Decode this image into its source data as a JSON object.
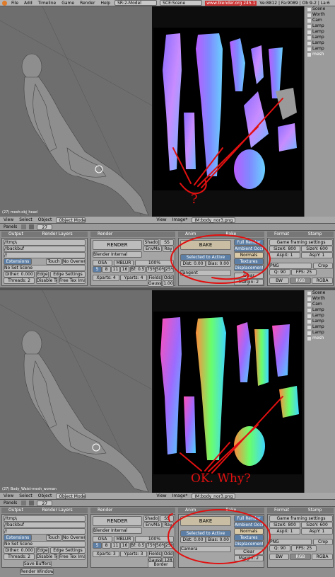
{
  "topbar": {
    "menus": [
      "File",
      "Add",
      "Timeline",
      "Game",
      "Render",
      "Help"
    ],
    "screen": "SR:2-Model",
    "scene": "SCE:Scene",
    "site": "www.blender.org 245.1",
    "stats": "Ve:8812 | Fa:9089 | Ob:9-2 | La:6"
  },
  "outliner": {
    "items": [
      "Scene",
      "Worth",
      "Cam",
      "Lamp",
      "Lamp",
      "Lamp",
      "Lamp",
      "Lamp",
      "mesh"
    ]
  },
  "top": {
    "status_label": "(27) mesh:obj_head",
    "annotation": "?"
  },
  "bottom": {
    "status_label": "(27) Body_Waist-mesh_woman",
    "annotation": "OK. Why?"
  },
  "view_header": {
    "view": "View",
    "select": "Select",
    "object": "Object",
    "mode": "Object Mode",
    "uv_view": "View",
    "image": "Image*",
    "image_name_top": "IM:body_nor3.png",
    "image_name_bottom": "IM:body_nor3.png"
  },
  "buttons_header": {
    "panels": "Panels",
    "frame": "27"
  },
  "panels": {
    "output": {
      "tab": "Output",
      "tab2": "Render Layers",
      "path1": "//tmp\\",
      "path2": "//backbuf",
      "path3": "//",
      "extensions": "Extensions",
      "touch": "Touch",
      "no_overwrite": "No Overwrite",
      "no_set_scene": "No Set Scene",
      "dither": "Dither: 0.000",
      "edge": "Edge",
      "edge_settings": "Edge Settings",
      "threads": "Threads: 2",
      "disable_tex": "Disable Tex",
      "free_tex": "Free Tex Imag",
      "save_buffers": "Save Buffers",
      "render_window": "Render Window"
    },
    "render": {
      "tab": "Render",
      "render_btn": "RENDER",
      "engine": "Blender Internal",
      "shadow": "Shado",
      "sss": "SS",
      "envmap": "EnvMa",
      "ray": "Ray",
      "osa": "OSA",
      "mblur": "MBLUR",
      "osa_vals": [
        "5",
        "8",
        "11",
        "16"
      ],
      "bf": "Bf: 0.50",
      "pct100": "100%",
      "pct75": "75%",
      "pct50": "50%",
      "pct25": "25%",
      "xparts": "Xparts: 4",
      "yparts": "Yparts: 4",
      "xparts_b": "Xparts: 3",
      "yparts_b": "Yparts: 3",
      "fields": "Fields",
      "odd": "Odd",
      "gauss": "Gauss",
      "gauss_val": "1.00",
      "gauss_val_b": "128",
      "border": "Border"
    },
    "bake": {
      "tab_anim": "Anim",
      "tab_bake": "Bake",
      "bake_btn": "BAKE",
      "selected_to_active": "Selected to Active",
      "dist": "Dist: 0.00",
      "bias": "Bias: 0.00",
      "space_top": "Tangent",
      "space_bottom": "Camera",
      "margin": "Margin: 2",
      "modes": [
        "Full Render",
        "Ambient Occlusi",
        "Normals",
        "Textures",
        "Displacement"
      ],
      "clear": "Clear"
    },
    "format": {
      "tab": "Format",
      "tab2": "Stamp",
      "game_framing": "Game framing settings",
      "sizex": "SizeX: 800",
      "sizey": "SizeY: 600",
      "aspx": "AspX: 1",
      "aspy": "AspY: 1",
      "png": "PNG",
      "crop": "Crop",
      "q": "Q: 90",
      "fps": "FPS: 25",
      "bw": "BW",
      "rgb": "RGB",
      "rgba": "RGBA"
    }
  }
}
